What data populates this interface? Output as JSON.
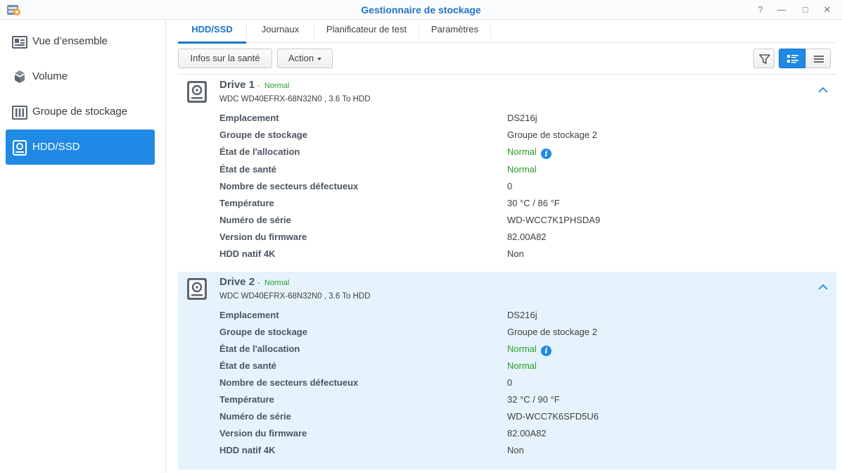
{
  "window": {
    "title": "Gestionnaire de stockage",
    "controls": [
      "?",
      "—",
      "□",
      "✕"
    ],
    "accent": "#1f74c9"
  },
  "sidebar": {
    "items": [
      {
        "label": "Vue d’ensemble",
        "icon": "overview-icon",
        "active": false
      },
      {
        "label": "Volume",
        "icon": "volume-icon",
        "active": false
      },
      {
        "label": "Groupe de stockage",
        "icon": "storage-pool-icon",
        "active": false
      },
      {
        "label": "HDD/SSD",
        "icon": "hdd-icon",
        "active": true
      }
    ],
    "active_color": "#1f89e5"
  },
  "tabs": [
    {
      "label": "HDD/SSD",
      "active": true
    },
    {
      "label": "Journaux",
      "active": false
    },
    {
      "label": "Planificateur de test",
      "active": false
    },
    {
      "label": "Paramètres",
      "active": false
    }
  ],
  "toolbar": {
    "health_label": "Infos sur la santé",
    "action_label": "Action",
    "icons": [
      "filter-icon",
      "detail-view-icon",
      "list-view-icon"
    ]
  },
  "drives": [
    {
      "name": "Drive 1",
      "status": "Normal",
      "model": "WDC WD40EFRX-68N32N0 , 3.6 To HDD",
      "selected": false,
      "fields": [
        {
          "key": "Emplacement",
          "value": "DS216j"
        },
        {
          "key": "Groupe de stockage",
          "value": "Groupe de stockage 2"
        },
        {
          "key": "État de l'allocation",
          "value": "Normal"
        },
        {
          "key": "État de santé",
          "value": "Normal"
        },
        {
          "key": "Nombre de secteurs défectueux",
          "value": "0"
        },
        {
          "key": "Température",
          "value": "30 °C / 86 °F"
        },
        {
          "key": "Numéro de série",
          "value": "WD-WCC7K1PHSDA9"
        },
        {
          "key": "Version du firmware",
          "value": "82.00A82"
        },
        {
          "key": "HDD natif 4K",
          "value": "Non"
        }
      ]
    },
    {
      "name": "Drive 2",
      "status": "Normal",
      "model": "WDC WD40EFRX-68N32N0 , 3.6 To HDD",
      "selected": true,
      "fields": [
        {
          "key": "Emplacement",
          "value": "DS216j"
        },
        {
          "key": "Groupe de stockage",
          "value": "Groupe de stockage 2"
        },
        {
          "key": "État de l'allocation",
          "value": "Normal"
        },
        {
          "key": "État de santé",
          "value": "Normal"
        },
        {
          "key": "Nombre de secteurs défectueux",
          "value": "0"
        },
        {
          "key": "Température",
          "value": "32 °C / 90 °F"
        },
        {
          "key": "Numéro de série",
          "value": "WD-WCC7K6SFD5U6"
        },
        {
          "key": "Version du firmware",
          "value": "82.00A82"
        },
        {
          "key": "HDD natif 4K",
          "value": "Non"
        }
      ]
    }
  ],
  "colors": {
    "status_ok": "#299b2a",
    "selected_row": "#e6f3fc",
    "info_icon": "#1f89e5"
  }
}
